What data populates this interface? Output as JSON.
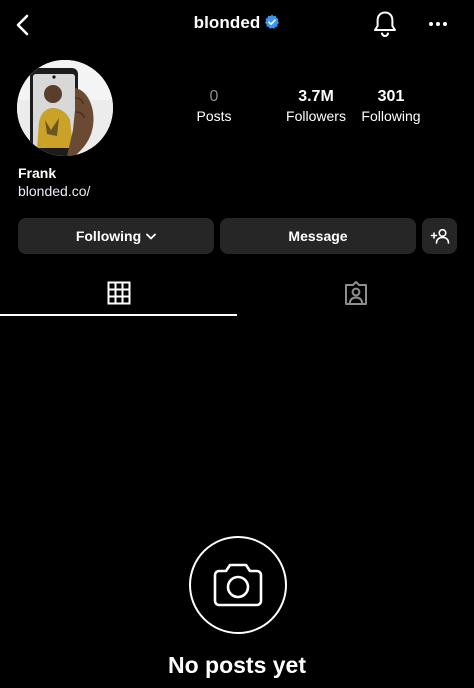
{
  "header": {
    "username": "blonded",
    "verified": true,
    "back_icon": "chevron-left-icon",
    "bell_icon": "bell-icon",
    "more_icon": "more-horizontal-icon"
  },
  "profile": {
    "display_name": "Frank",
    "link": "blonded.co/"
  },
  "stats": {
    "posts_count": "0",
    "posts_label": "Posts",
    "followers_count": "3.7M",
    "followers_label": "Followers",
    "following_count": "301",
    "following_label": "Following"
  },
  "actions": {
    "following_label": "Following",
    "message_label": "Message"
  },
  "tabs": {
    "active": "grid",
    "items": [
      "grid-icon",
      "tagged-person-icon"
    ]
  },
  "empty_state": {
    "text": "No posts yet",
    "icon": "camera-icon"
  },
  "colors": {
    "background": "#000000",
    "button": "#262626",
    "verified_badge": "#3897f0",
    "muted": "#8e8e8e"
  }
}
